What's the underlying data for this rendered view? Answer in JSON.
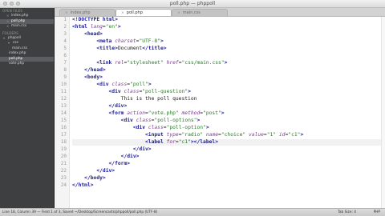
{
  "window": {
    "title": "poll.php — phppoll"
  },
  "sidebar": {
    "open_files_header": "OPEN FILES",
    "open_files": [
      {
        "label": "index.php",
        "active": false
      },
      {
        "label": "poll.php",
        "active": true
      },
      {
        "label": "main.css",
        "active": false
      }
    ],
    "folders_header": "FOLDERS",
    "root_folder": "phppoll",
    "css_folder": "css",
    "css_files": [
      "main.css"
    ],
    "root_files": [
      {
        "label": "index.php",
        "active": false
      },
      {
        "label": "poll.php",
        "active": true
      },
      {
        "label": "vote.php",
        "active": false
      }
    ]
  },
  "tabs": [
    {
      "label": "index.php",
      "active": false
    },
    {
      "label": "poll.php",
      "active": true
    },
    {
      "label": "main.css",
      "active": false
    }
  ],
  "editor": {
    "line_numbers": [
      "1",
      "2",
      "3",
      "4",
      "5",
      "6",
      "7",
      "8",
      "9",
      "10",
      "11",
      "12",
      "13",
      "14",
      "15",
      "16",
      "17",
      "18",
      "19",
      "20",
      "21",
      "22",
      "23",
      "24"
    ],
    "current_line": 18
  },
  "status": {
    "position": "Line 18, Column 39 — Field 1 of 3, Saved ~/Desktop/Screencasts/phppoll/poll.php (UTF-8)",
    "tab_size": "Tab Size: 4",
    "syntax": "PHP"
  }
}
